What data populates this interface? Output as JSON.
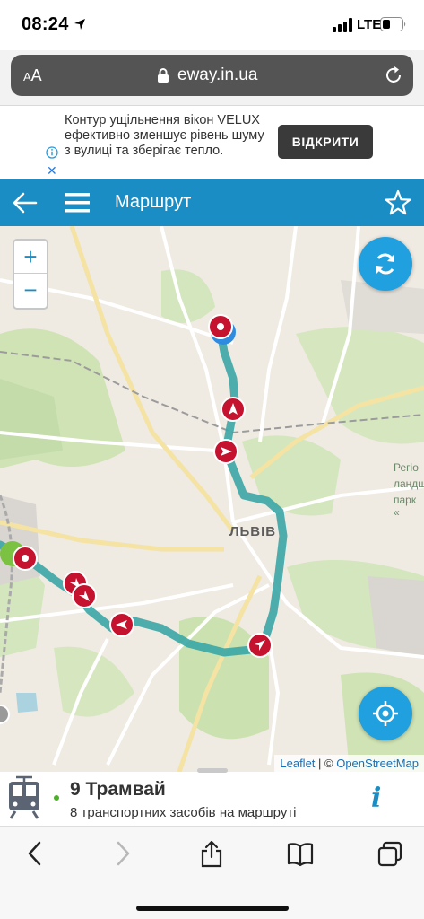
{
  "status": {
    "time": "08:24",
    "network": "LTE"
  },
  "browser": {
    "aa_label": "AA",
    "url": "eway.in.ua"
  },
  "ad": {
    "text": "Контур ущільнення вікон VELUX ефективно зменшує рівень шуму з вулиці та зберігає тепло.",
    "button_label": "ВІДКРИТИ"
  },
  "header": {
    "title": "Маршрут"
  },
  "map": {
    "zoom_in": "+",
    "zoom_out": "−",
    "city_label": "ЛЬВІВ",
    "side_labels": [
      "Регіо",
      "ландш",
      "парк «"
    ],
    "attribution": {
      "leaflet": "Leaflet",
      "separator": " | © ",
      "osm": "OpenStreetMap"
    },
    "route_color": "#3aa6a6",
    "marker_color": "#c4122f"
  },
  "route": {
    "title": "9 Трамвай",
    "subtitle": "8 транспортних засобів на маршруті",
    "info_label": "i"
  },
  "icons": {
    "back": "back-arrow-icon",
    "menu": "hamburger-menu-icon",
    "favorite": "star-icon",
    "refresh": "refresh-icon",
    "locate": "locate-icon",
    "tram": "tram-icon"
  }
}
